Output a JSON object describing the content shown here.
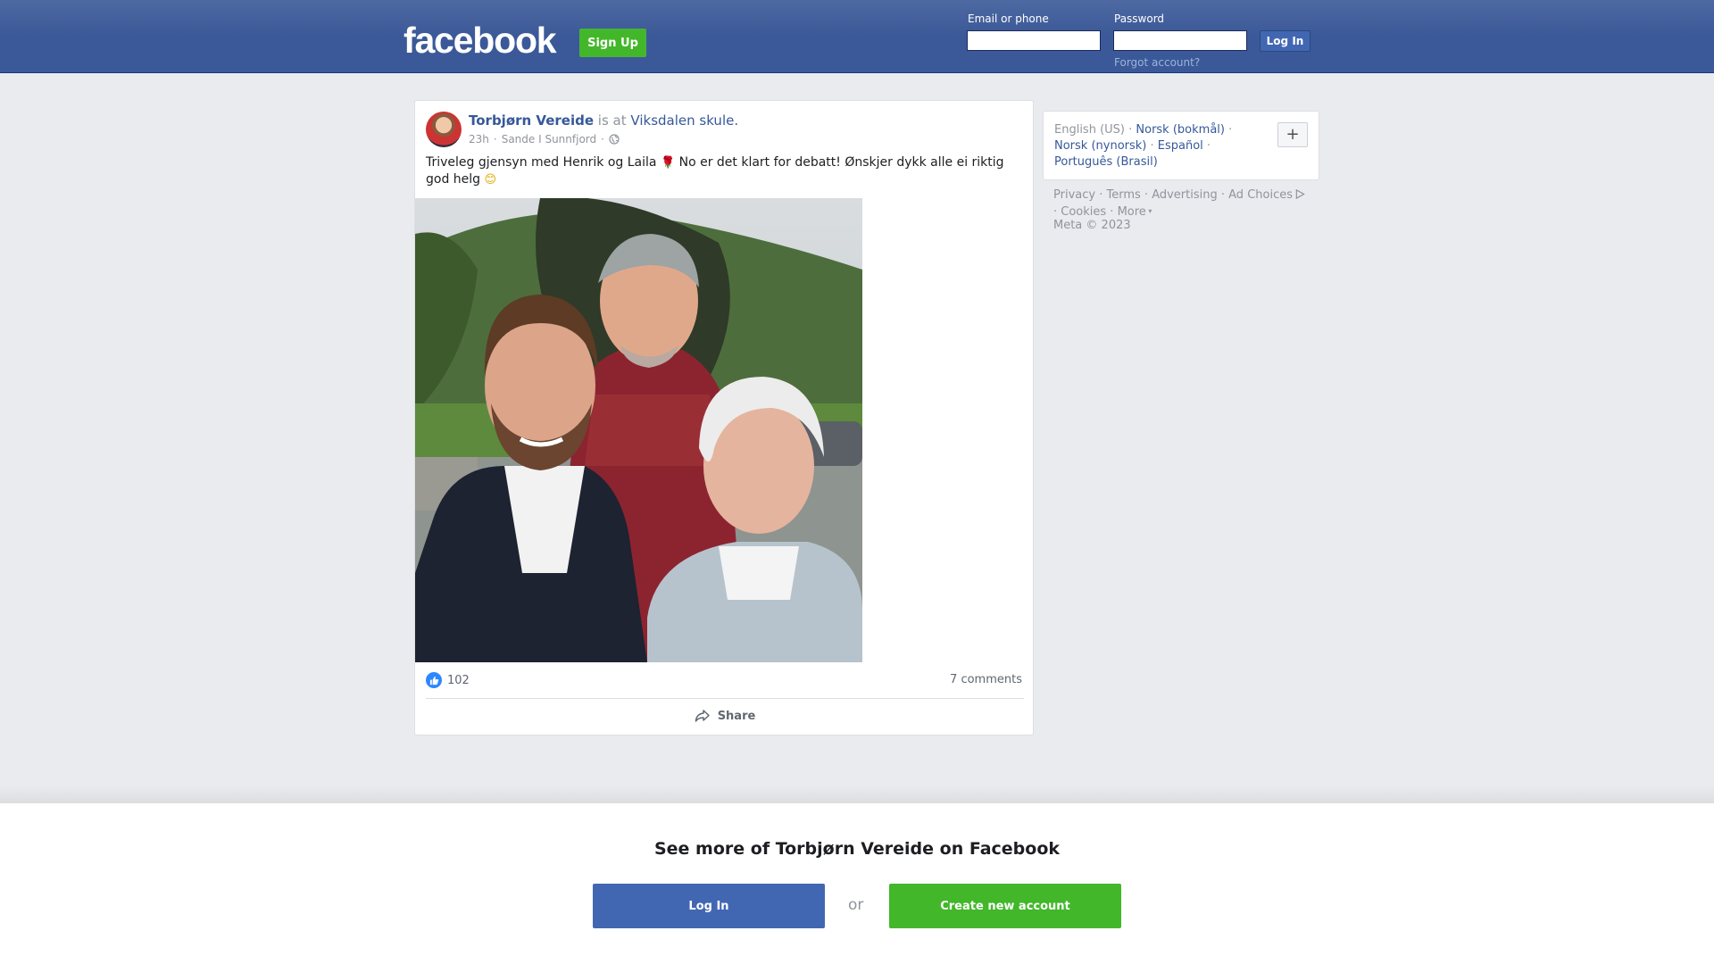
{
  "header": {
    "logo": "facebook",
    "signup_label": "Sign Up",
    "email_label": "Email or phone",
    "password_label": "Password",
    "login_label": "Log In",
    "forgot_label": "Forgot account?"
  },
  "post": {
    "author": "Torbjørn Vereide",
    "is_at": "is at",
    "place": "Viksdalen skule.",
    "time": "23h",
    "location": "Sande I Sunnfjord",
    "text_part1": "Triveleg gjensyn med Henrik og Laila",
    "rose": "🌹",
    "text_part2": "No er det klart for debatt! Ønskjer dykk alle ei riktig god helg",
    "smile": "😊",
    "likes": "102",
    "comments": "7 comments",
    "share_label": "Share"
  },
  "sidebar": {
    "languages": [
      "English (US)",
      "Norsk (bokmål)",
      "Norsk (nynorsk)",
      "Español",
      "Português (Brasil)"
    ],
    "plus_label": "+",
    "footer_links": [
      "Privacy",
      "Terms",
      "Advertising",
      "Ad Choices",
      "Cookies",
      "More"
    ],
    "copyright": "Meta © 2023"
  },
  "bottom": {
    "title": "See more of Torbjørn Vereide on Facebook",
    "login_label": "Log In",
    "or_label": "or",
    "create_label": "Create new account"
  },
  "colors": {
    "brand_blue": "#3b5998",
    "link_blue": "#365899",
    "button_blue": "#4267b2",
    "signup_green": "#42b72a"
  }
}
